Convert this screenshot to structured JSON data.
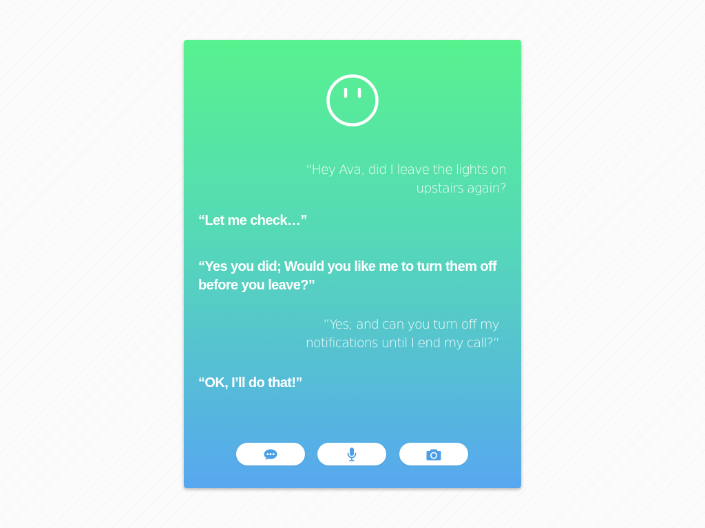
{
  "colors": {
    "gradient_top": "#58f28f",
    "gradient_mid": "#55d8b8",
    "gradient_bottom": "#57a7ef",
    "icon_blue": "#4d9fe5",
    "text": "#ffffff"
  },
  "assistant": {
    "face_icon": "smiley-face-icon"
  },
  "conversation": [
    {
      "speaker": "user",
      "text": "“Hey Ava, did I leave the lights on upstairs again?"
    },
    {
      "speaker": "assistant",
      "text": "“Let me check…”"
    },
    {
      "speaker": "assistant",
      "text": "“Yes you did; Would you like me to turn them off before you leave?”"
    },
    {
      "speaker": "user",
      "text": "”Yes; and can you turn off my notifications until I end my call?”"
    },
    {
      "speaker": "assistant",
      "text": "“OK, I’ll do that!”"
    }
  ],
  "toolbar": {
    "buttons": [
      {
        "icon": "chat-bubble-icon"
      },
      {
        "icon": "microphone-icon"
      },
      {
        "icon": "camera-icon"
      }
    ]
  }
}
